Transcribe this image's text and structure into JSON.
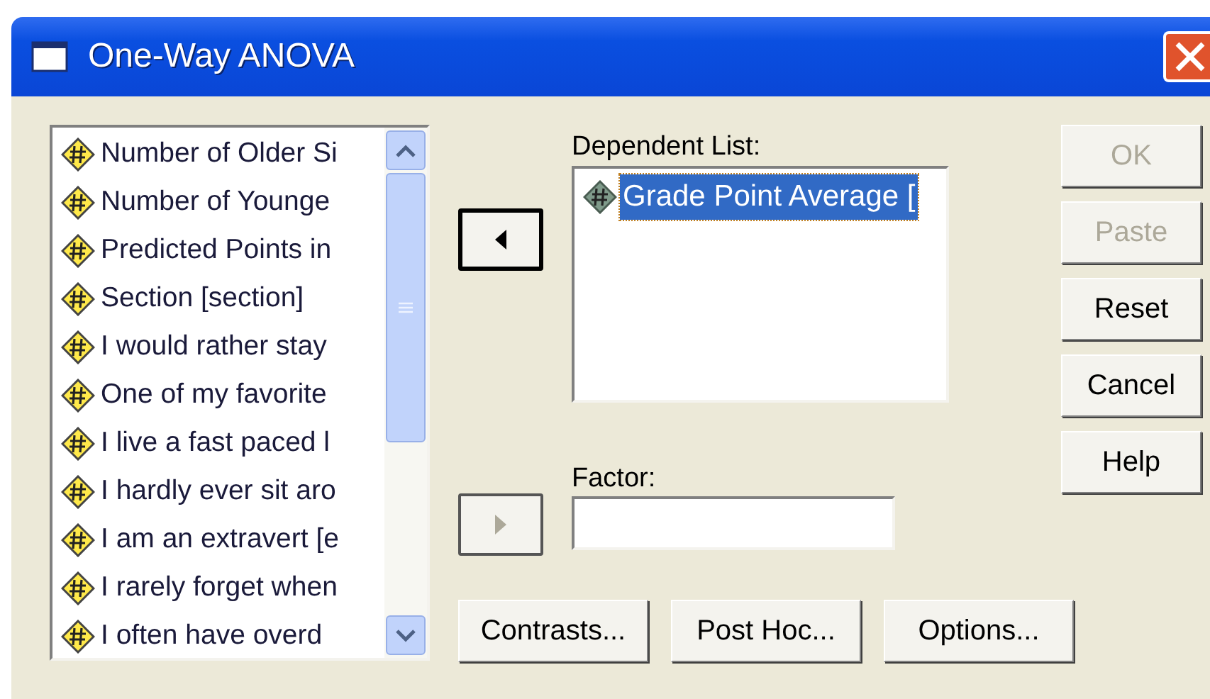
{
  "window": {
    "title": "One-Way ANOVA"
  },
  "variables": [
    {
      "label": "Number of Older Si",
      "selected": false
    },
    {
      "label": "Number of Younge",
      "selected": false
    },
    {
      "label": "Predicted Points in",
      "selected": false
    },
    {
      "label": "Section [section]",
      "selected": false
    },
    {
      "label": "I would rather stay",
      "selected": false
    },
    {
      "label": "One of my favorite",
      "selected": false
    },
    {
      "label": "I live a fast paced l",
      "selected": false
    },
    {
      "label": "I hardly ever sit aro",
      "selected": false
    },
    {
      "label": "I am an extravert [e",
      "selected": false
    },
    {
      "label": "I rarely forget when",
      "selected": false
    },
    {
      "label": "I often have overd",
      "selected": false
    }
  ],
  "arrows": [
    {
      "kind": "left",
      "disabled": false
    },
    {
      "kind": "right",
      "disabled": true
    }
  ],
  "dependent_list": {
    "label": "Dependent List:",
    "items": [
      {
        "label": "Grade Point Average [",
        "selected": true
      }
    ]
  },
  "factor": {
    "label": "Factor:"
  },
  "bottom_buttons": [
    {
      "label": "Contrasts...",
      "disabled": false
    },
    {
      "label": "Post Hoc...",
      "disabled": false
    },
    {
      "label": "Options...",
      "disabled": false
    }
  ],
  "side_buttons": [
    {
      "label": "OK",
      "disabled": true
    },
    {
      "label": "Paste",
      "disabled": true
    },
    {
      "label": "Reset",
      "disabled": false
    },
    {
      "label": "Cancel",
      "disabled": false
    },
    {
      "label": "Help",
      "disabled": false
    }
  ]
}
